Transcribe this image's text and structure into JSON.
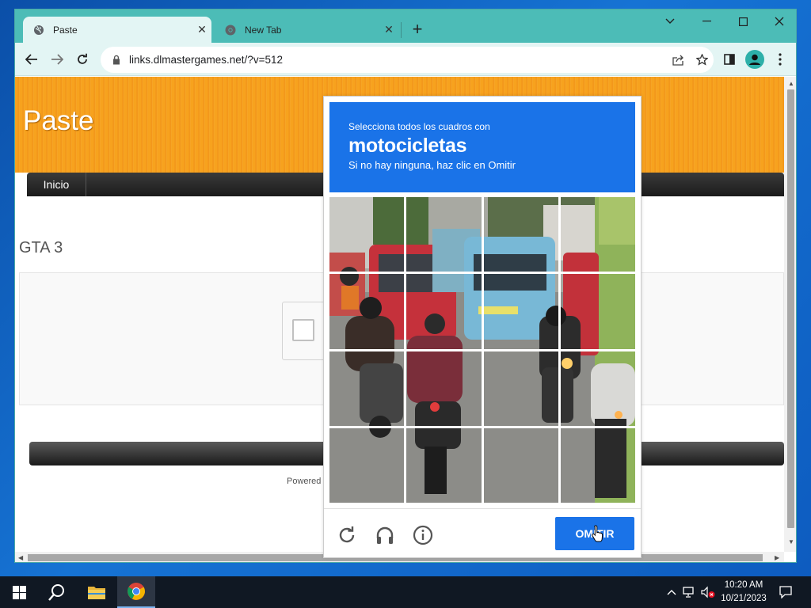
{
  "browser": {
    "tabs": [
      {
        "title": "Paste",
        "icon": "globe-icon",
        "active": true
      },
      {
        "title": "New Tab",
        "icon": "chrome-icon",
        "active": false
      }
    ],
    "new_tab_label": "+",
    "url": "links.dlmastergames.net/?v=512"
  },
  "site": {
    "title": "Paste",
    "nav": [
      "Inicio"
    ],
    "heading": "GTA 3",
    "powered": "Powered"
  },
  "captcha": {
    "instruction": "Selecciona todos los cuadros con",
    "target": "motocicletas",
    "hint": "Si no hay ninguna, haz clic en Omitir",
    "skip_label": "OMITIR",
    "header_color": "#1a73e8",
    "grid_size": "4x4"
  },
  "taskbar": {
    "time": "10:20 AM",
    "date": "10/21/2023"
  }
}
